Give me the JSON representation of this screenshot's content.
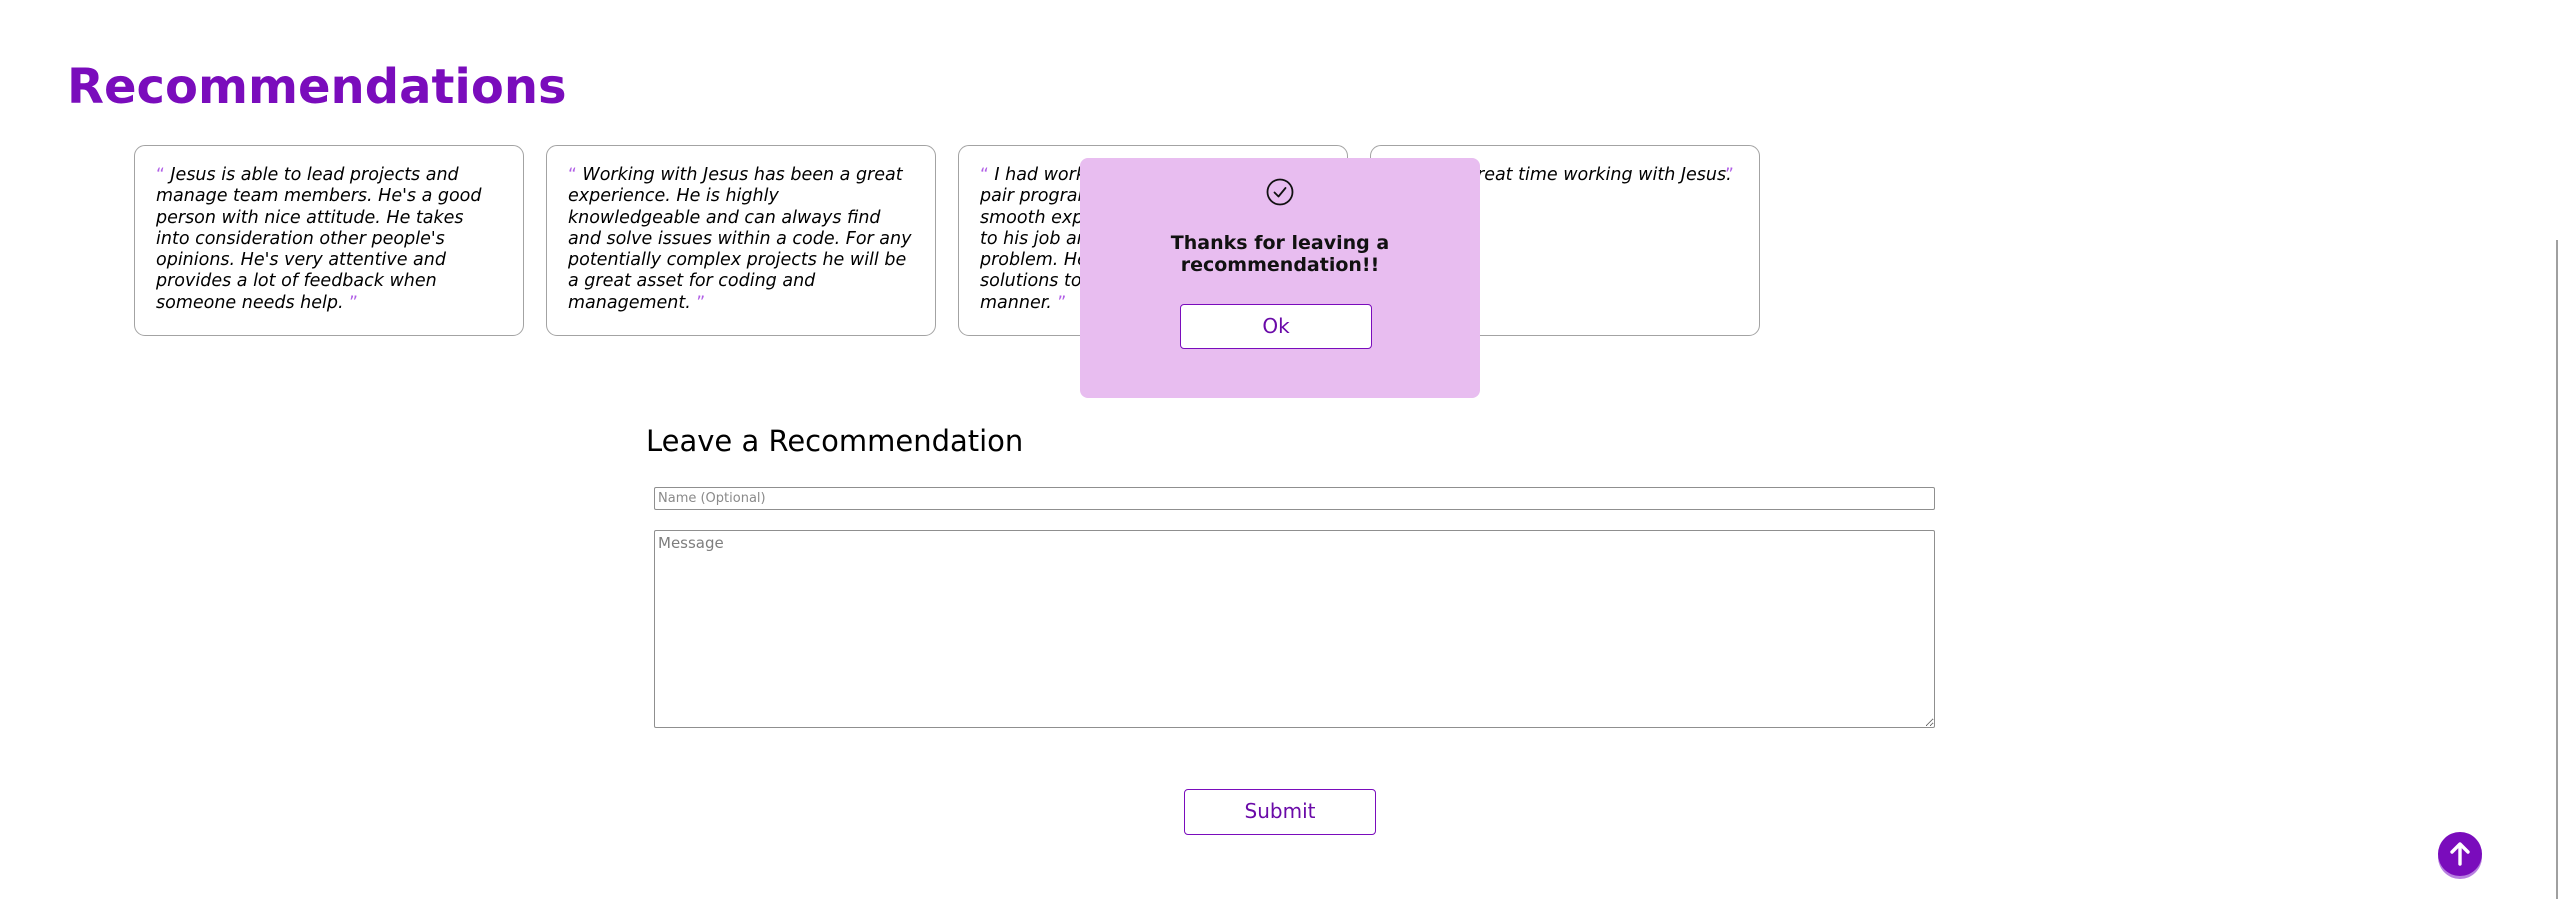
{
  "section": {
    "title": "Recommendations"
  },
  "recommendations": [
    {
      "open_quote": "“",
      "text": "Jesus is able to lead projects and manage team members. He's a good person with nice attitude. He takes into consideration other people's opinions. He's very attentive and provides a lot of feedback when someone needs help.",
      "close_quote": "”"
    },
    {
      "open_quote": "“",
      "text": "Working with Jesus has been a great experience. He is highly knowledgeable and can always find and solve issues within a code. For any potentially complex projects he will be a great asset for coding and management.",
      "close_quote": "”"
    },
    {
      "open_quote": "“",
      "text_lines": [
        "I had work",
        "pair program",
        "smooth expe",
        "to his job an",
        "problem. He",
        "solutions to",
        "manner."
      ],
      "close_quote": "”"
    },
    {
      "text_visible": "reat time working with Jesus.",
      "close_quote": "”"
    }
  ],
  "modal": {
    "icon": "check-circle-icon",
    "message": "Thanks for leaving a recommendation!!",
    "ok_label": "Ok"
  },
  "form": {
    "title": "Leave a Recommendation",
    "name_placeholder": "Name (Optional)",
    "name_value": "",
    "message_placeholder": "Message",
    "message_value": "",
    "submit_label": "Submit"
  },
  "scroll_top": {
    "icon": "arrow-up-icon"
  },
  "colors": {
    "accent": "#7a0cbc",
    "quote_mark": "#b05ee6",
    "modal_bg": "#e8bdf0",
    "card_border": "#a3a3a3"
  }
}
